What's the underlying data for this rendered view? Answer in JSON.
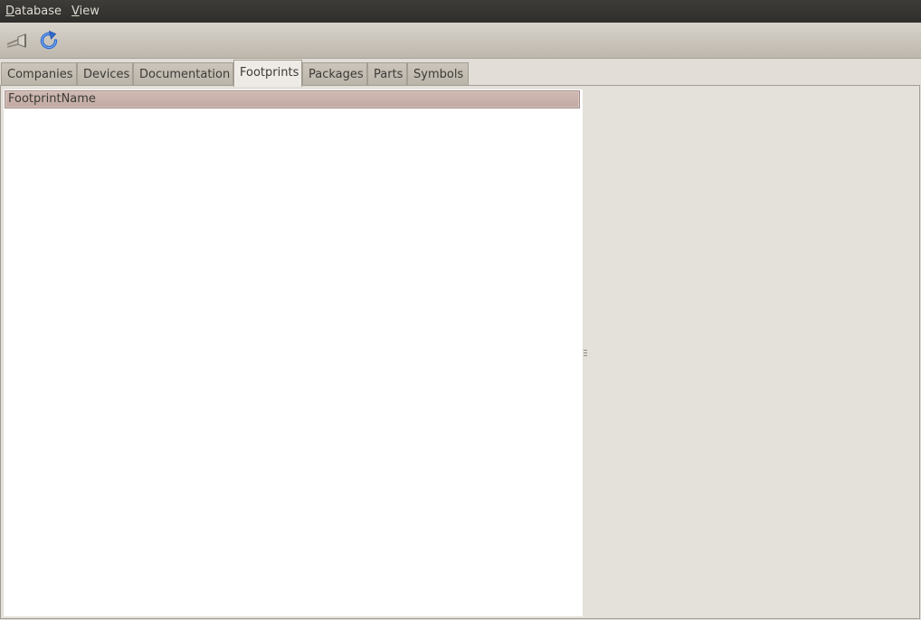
{
  "menubar": {
    "items": [
      {
        "mnemonic": "D",
        "rest": "atabase"
      },
      {
        "mnemonic": "V",
        "rest": "iew"
      }
    ]
  },
  "toolbar": {
    "buttons": [
      {
        "icon": "connect-icon"
      },
      {
        "icon": "refresh-icon"
      }
    ]
  },
  "tabs": [
    {
      "label": "Companies"
    },
    {
      "label": "Devices"
    },
    {
      "label": "Documentation"
    },
    {
      "label": "Footprints",
      "active": true
    },
    {
      "label": "Packages"
    },
    {
      "label": "Parts"
    },
    {
      "label": "Symbols"
    }
  ],
  "table": {
    "columns": [
      "FootprintName"
    ],
    "rows": []
  },
  "colors": {
    "menubar_bg": "#3c3b37",
    "toolbar_bg": "#cfc9c0",
    "header_bg": "#c9b2ab",
    "refresh_blue": "#2e6bd1"
  }
}
